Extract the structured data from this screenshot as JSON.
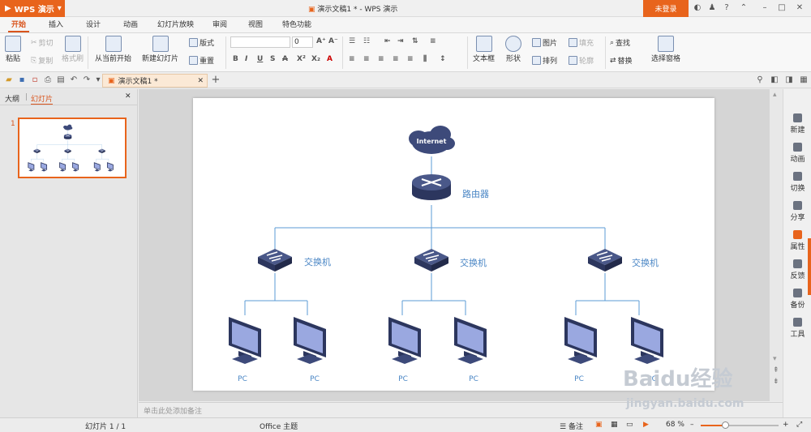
{
  "app": {
    "name": "WPS 演示",
    "doc_title": "演示文稿1 * - WPS 演示",
    "login": "未登录"
  },
  "tabs": [
    "开始",
    "插入",
    "设计",
    "动画",
    "幻灯片放映",
    "审阅",
    "视图",
    "特色功能"
  ],
  "ribbon": {
    "paste": "粘贴",
    "cut": "剪切",
    "copy": "复制",
    "format_painter": "格式刷",
    "from_current": "从当前开始",
    "new_slide": "新建幻灯片",
    "layout": "版式",
    "reset": "重置",
    "font_size": "0",
    "textbox": "文本框",
    "shape": "形状",
    "picture": "图片",
    "fill": "填充",
    "arrange": "排列",
    "outline": "轮廓",
    "find": "查找",
    "replace": "替换",
    "select_pane": "选择窗格"
  },
  "doc_tab": "演示文稿1 *",
  "left_panel": {
    "outline": "大纲",
    "slides": "幻灯片",
    "slide_number": "1"
  },
  "slide": {
    "cloud": "Internet",
    "router": "路由器",
    "switches": [
      "交换机",
      "交换机",
      "交换机"
    ],
    "pcs": [
      "PC",
      "PC",
      "PC",
      "PC",
      "PC",
      "PC"
    ]
  },
  "notes_placeholder": "单击此处添加备注",
  "right_panel": [
    "新建",
    "动画",
    "切换",
    "分享",
    "属性",
    "反馈",
    "备份",
    "工具"
  ],
  "status": {
    "slide_info": "幻灯片 1 / 1",
    "theme": "Office 主题",
    "notes": "备注",
    "zoom": "68 %"
  },
  "watermark": {
    "logo": "Baidu经验",
    "url": "jingyan.baidu.com"
  },
  "colors": {
    "accent": "#e8641c",
    "device": "#3d4a7a",
    "link": "#4a86c5"
  }
}
